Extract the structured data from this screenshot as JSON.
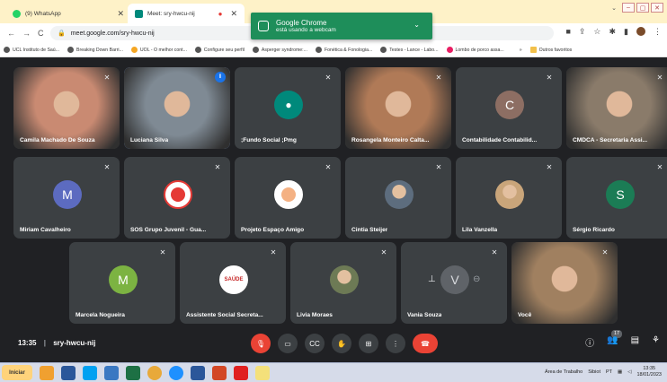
{
  "browser": {
    "tabs": [
      {
        "title": "(9) WhatsApp",
        "icon": "whatsapp-icon",
        "color": "#25d366"
      },
      {
        "title": "Meet: sry-hwcu-nij",
        "icon": "meet-icon",
        "color": "#00897b"
      }
    ],
    "url": "meet.google.com/sry-hwcu-nij",
    "bookmarks": [
      "UCL Instituto de Saú...",
      "Breaking Down Barri...",
      "UOL - O melhor cont...",
      "Configure seu perfil",
      "Asperger syndrome:...",
      "Fonética & Fonologia...",
      "Testes - Lance - Labo...",
      "Lombo de porco assa...",
      "Outros favoritos"
    ],
    "more_bookmarks": "»"
  },
  "notification": {
    "title": "Google Chrome",
    "message": "está usando a webcam"
  },
  "participants": [
    {
      "name": "Camila Machado De Souza",
      "type": "photo",
      "color": "#c98a72"
    },
    {
      "name": "Luciana Silva",
      "type": "photo",
      "color": "#7f8a94",
      "speaking": true
    },
    {
      "name": ";Fundo Social ;Pmg",
      "type": "avatar",
      "initial": "",
      "color": "#00897b"
    },
    {
      "name": "Rosangela Monteiro Calta...",
      "type": "photo",
      "color": "#b07a57"
    },
    {
      "name": "Contabilidade Contabilid...",
      "type": "avatar",
      "initial": "C",
      "color": "#8d6e63"
    },
    {
      "name": "CMDCA - Secretaria Assi...",
      "type": "photo",
      "color": "#8a7b6a"
    },
    {
      "name": "Miriam Cavalheiro",
      "type": "avatar",
      "initial": "M",
      "color": "#5c6bc0"
    },
    {
      "name": "SOS Grupo Juvenil - Gua...",
      "type": "logo",
      "initial": "",
      "color": "#e53935"
    },
    {
      "name": "Projeto Espaço Amigo",
      "type": "logo",
      "initial": "",
      "color": "#ffffff"
    },
    {
      "name": "Cintia Steijer",
      "type": "photo-round",
      "color": "#5d6d7e"
    },
    {
      "name": "Lila Vanzella",
      "type": "photo-round",
      "color": "#c9a57a"
    },
    {
      "name": "Sérgio Ricardo",
      "type": "avatar",
      "initial": "S",
      "color": "#1b7c55"
    },
    {
      "name": "Marcela Nogueira",
      "type": "avatar",
      "initial": "M",
      "color": "#7cb342"
    },
    {
      "name": "Assistente Social Secreta...",
      "type": "logo-saude",
      "initial": "SAÚDE",
      "color": "#ffffff"
    },
    {
      "name": "Livia Moraes",
      "type": "photo-round",
      "color": "#6d7a55"
    },
    {
      "name": "Vania Souza",
      "type": "presenting",
      "initial": "V",
      "color": "#5f6368"
    },
    {
      "name": "Você",
      "type": "photo",
      "color": "#a08060"
    }
  ],
  "meeting": {
    "time": "13:35",
    "separator": "|",
    "code": "sry-hwcu-nij",
    "participant_count": "17"
  },
  "taskbar": {
    "start_label": "Iniciar",
    "tray_text": "Área de Trabalho",
    "sibiot": "Sibiot",
    "lang": "PT",
    "clock_time": "13:35",
    "clock_date": "18/01/2023"
  }
}
